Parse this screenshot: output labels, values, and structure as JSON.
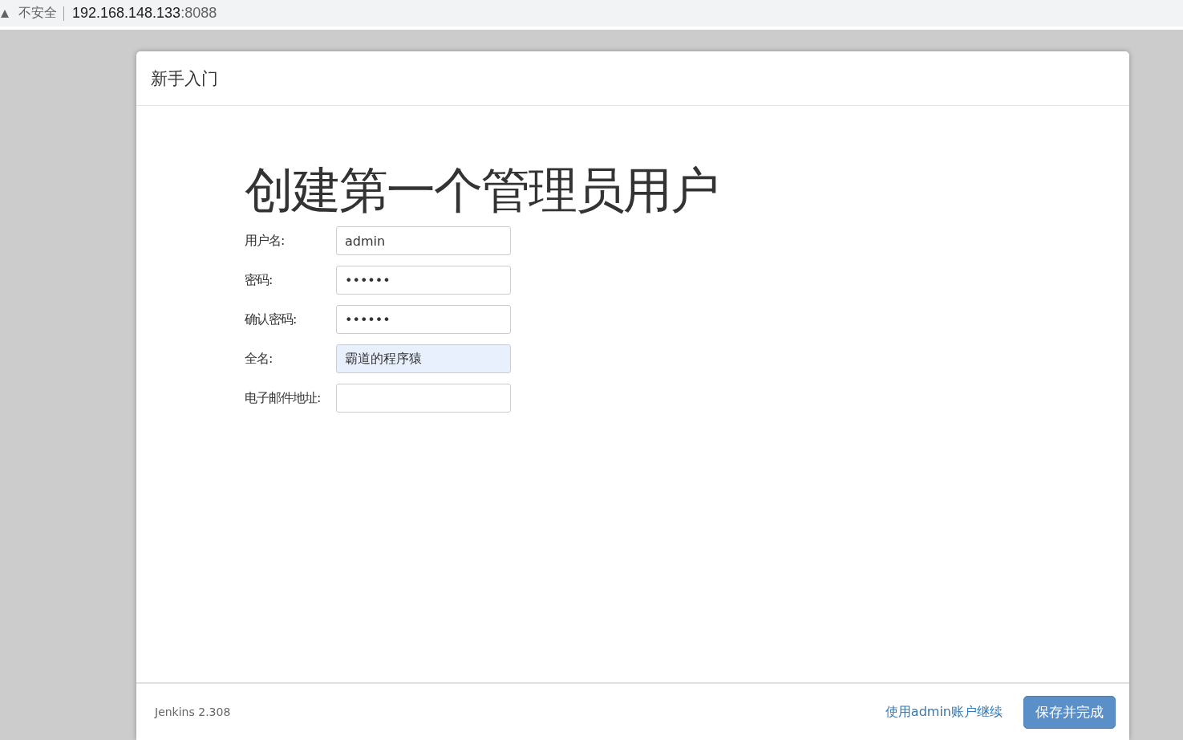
{
  "address_bar": {
    "security": "不安全",
    "url_host": "192.168.148.133",
    "url_port": ":8088"
  },
  "dialog": {
    "title": "新手入门",
    "heading": "创建第一个管理员用户",
    "fields": [
      {
        "label": "用户名:",
        "value": "admin",
        "autofilled": false
      },
      {
        "label": "密码:",
        "value": "••••••",
        "autofilled": false
      },
      {
        "label": "确认密码:",
        "value": "••••••",
        "autofilled": false
      },
      {
        "label": "全名:",
        "value": "霸道的程序猿",
        "autofilled": true
      },
      {
        "label": "电子邮件地址:",
        "autofilled": false
      }
    ],
    "version": "Jenkins 2.308",
    "skip_link": "使用admin账户继续",
    "save_button": "保存并完成"
  }
}
